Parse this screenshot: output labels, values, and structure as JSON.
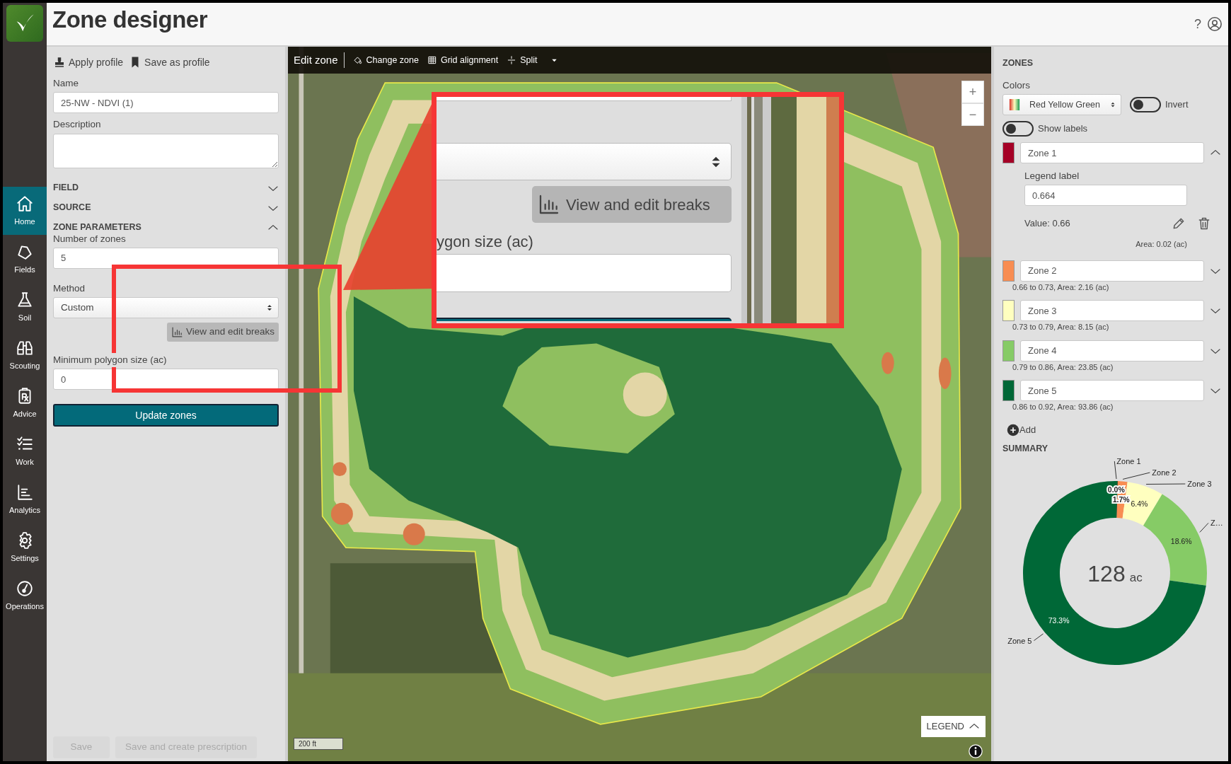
{
  "app": {
    "title": "Zone designer",
    "help": "?"
  },
  "sidebar": {
    "items": [
      {
        "label": "Home",
        "selected": true
      },
      {
        "label": "Fields",
        "selected": false
      },
      {
        "label": "Soil",
        "selected": false
      },
      {
        "label": "Scouting",
        "selected": false
      },
      {
        "label": "Advice",
        "selected": false
      },
      {
        "label": "Work",
        "selected": false
      },
      {
        "label": "Analytics",
        "selected": false
      },
      {
        "label": "Settings",
        "selected": false
      },
      {
        "label": "Operations",
        "selected": false
      }
    ]
  },
  "left_panel": {
    "profile_actions": [
      {
        "label": "Apply profile"
      },
      {
        "label": "Save as profile"
      }
    ],
    "name_field": {
      "label": "Name",
      "value": "25-NW - NDVI (1)"
    },
    "description_field": {
      "label": "Description"
    },
    "sections": [
      {
        "title": "FIELD",
        "expanded": false
      },
      {
        "title": "SOURCE",
        "expanded": false
      },
      {
        "title": "ZONE PARAMETERS",
        "expanded": true
      }
    ],
    "zone_parameters": {
      "zone_count": {
        "label": "Number of zones",
        "value": "5"
      },
      "method": {
        "label": "Method",
        "value": "Custom"
      },
      "breaks_button": "View and edit breaks",
      "min_polygon": {
        "label": "Minimum polygon size (ac)",
        "value": "0"
      },
      "update_button": "Update zones"
    },
    "footer_buttons": [
      {
        "label": "Save",
        "disabled": true
      },
      {
        "label": "Save and create prescription",
        "disabled": true
      }
    ]
  },
  "map": {
    "toolbar": {
      "title": "Edit zone",
      "tools": [
        {
          "label": "Change zone",
          "has_menu": false
        },
        {
          "label": "Grid alignment",
          "has_menu": false
        },
        {
          "label": "Split",
          "has_menu": true
        }
      ]
    },
    "zoom_controls": [
      "+",
      "−"
    ],
    "scale": "200 ft",
    "legend_button": "LEGEND"
  },
  "callout": {
    "breaks_button": "View and edit breaks",
    "field_label": "ygon size (ac)"
  },
  "zones_panel": {
    "title": "ZONES",
    "colors_label": "Colors",
    "palette": "Red Yellow Green",
    "invert": {
      "label": "Invert",
      "on": false
    },
    "show_labels": {
      "label": "Show labels",
      "on": false
    },
    "zones": [
      {
        "name": "Zone 1",
        "color": "#a50026",
        "expanded": true,
        "legend_label": "Legend label",
        "legend_value": "0.664",
        "value_text": "Value: 0.66",
        "area_text": "Area: 0.02 (ac)"
      },
      {
        "name": "Zone 2",
        "color": "#f88d52",
        "expanded": false,
        "summary": "0.66 to 0.73, Area: 2.16 (ac)"
      },
      {
        "name": "Zone 3",
        "color": "#ffffbf",
        "expanded": false,
        "summary": "0.73 to 0.79, Area: 8.15 (ac)"
      },
      {
        "name": "Zone 4",
        "color": "#86cb66",
        "expanded": false,
        "summary": "0.79 to 0.86, Area: 23.85 (ac)"
      },
      {
        "name": "Zone 5",
        "color": "#006837",
        "expanded": false,
        "summary": "0.86 to 0.92, Area: 93.86 (ac)"
      }
    ],
    "add_button": "Add",
    "summary_title": "SUMMARY",
    "summary": {
      "total": "128",
      "unit": "ac",
      "chart_data": {
        "type": "donut",
        "categories": [
          "Zone 1",
          "Zone 2",
          "Zone 3",
          "Z…",
          "Zone 5"
        ],
        "values": [
          0.02,
          1.7,
          6.4,
          18.6,
          73.3
        ],
        "value_labels": [
          "0.0%",
          "1.7%",
          "6.4%",
          "18.6%",
          "73.3%"
        ]
      }
    }
  }
}
